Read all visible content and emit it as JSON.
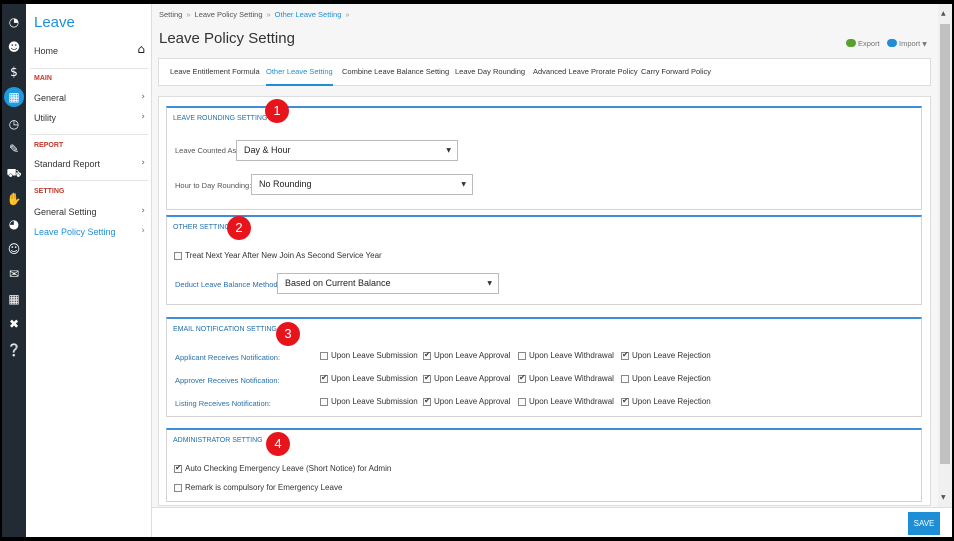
{
  "sidebar": {
    "app_title": "Leave",
    "home_label": "Home",
    "sections": {
      "main": "MAIN",
      "report": "REPORT",
      "setting": "SETTING"
    },
    "items": {
      "general": "General",
      "utility": "Utility",
      "standard_report": "Standard Report",
      "general_setting": "General Setting",
      "leave_policy_setting": "Leave Policy Setting"
    }
  },
  "breadcrumb": [
    "Setting",
    "Leave Policy Setting",
    "Other Leave Setting"
  ],
  "page_title": "Leave Policy Setting",
  "actions": {
    "export": "Export",
    "import": "Import"
  },
  "tabs": [
    "Leave Entitlement Formula",
    "Other Leave Setting",
    "Combine Leave Balance Setting",
    "Leave Day Rounding",
    "Advanced Leave Prorate Policy",
    "Carry Forward Policy"
  ],
  "active_tab": "Other Leave Setting",
  "panels": {
    "rounding": {
      "title": "LEAVE ROUNDING SETTING",
      "badge": "1",
      "counted_as_label": "Leave Counted As:",
      "counted_as_value": "Day & Hour",
      "hour_to_day_label": "Hour to Day Rounding:",
      "hour_to_day_value": "No Rounding"
    },
    "other": {
      "title": "OTHER SETTING",
      "badge": "2",
      "treat_next_year_label": "Treat Next Year After New Join As Second Service Year",
      "treat_next_year_checked": false,
      "deduct_method_label": "Deduct Leave Balance Method:",
      "deduct_method_value": "Based on Current Balance"
    },
    "email": {
      "title": "EMAIL NOTIFICATION SETTING",
      "badge": "3",
      "options": [
        "Upon Leave Submission",
        "Upon Leave Approval",
        "Upon Leave Withdrawal",
        "Upon Leave Rejection"
      ],
      "rows": [
        {
          "label": "Applicant Receives Notification:",
          "checked": [
            false,
            true,
            false,
            true
          ]
        },
        {
          "label": "Approver Receives Notification:",
          "checked": [
            true,
            true,
            true,
            false
          ]
        },
        {
          "label": "Listing Receives Notification:",
          "checked": [
            false,
            true,
            false,
            true
          ]
        }
      ]
    },
    "admin": {
      "title": "ADMINISTRATOR SETTING",
      "badge": "4",
      "auto_check_label": "Auto Checking Emergency Leave (Short Notice) for Admin",
      "auto_check_checked": true,
      "remark_label": "Remark is compulsory for Emergency Leave",
      "remark_checked": false
    }
  },
  "save_label": "SAVE",
  "colors": {
    "accent": "#1e8fd6",
    "badge": "#e8141c",
    "rail": "#222a33"
  },
  "icons": [
    "dashboard-icon",
    "user-icon",
    "payroll-icon",
    "calendar-icon",
    "clock-icon",
    "claim-icon",
    "truck-icon",
    "appraisal-icon",
    "pie-icon",
    "smile-icon",
    "form-icon",
    "table-icon",
    "tools-icon",
    "help-icon",
    "home-icon"
  ]
}
